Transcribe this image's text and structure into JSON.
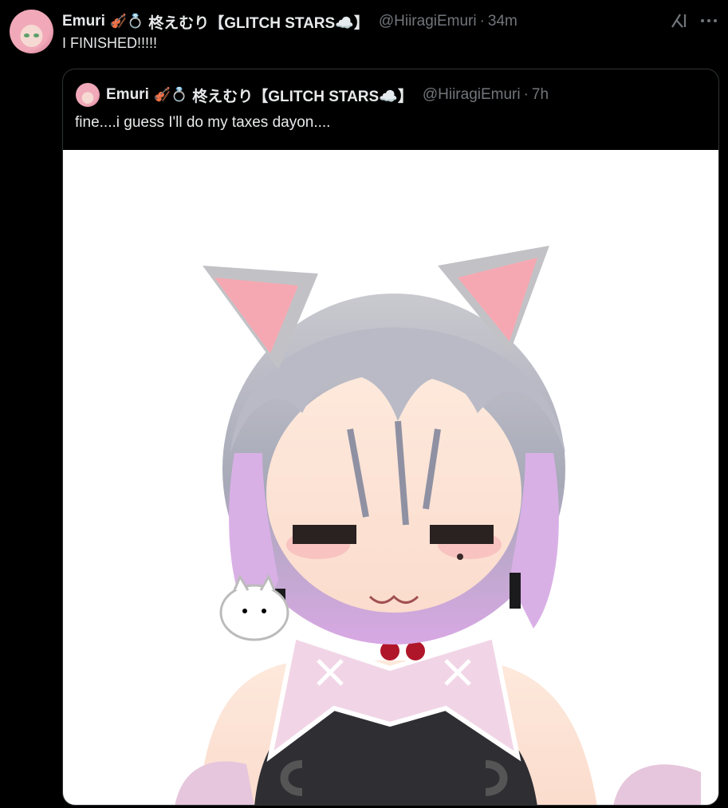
{
  "post": {
    "author_name": "Emuri",
    "author_emoji": "🎻💍",
    "author_suffix": "柊えむり【GLITCH STARS☁️】",
    "handle": "@HiiragiEmuri",
    "separator": "·",
    "time": "34m",
    "text": "I FINISHED!!!!!"
  },
  "quote": {
    "author_name": "Emuri",
    "author_emoji": "🎻💍",
    "author_suffix": "柊えむり【GLITCH STARS☁️】",
    "handle": "@HiiragiEmuri",
    "separator": "·",
    "time": "7h",
    "text": "fine....i guess I'll do my taxes dayon...."
  },
  "icons": {
    "grok": "grok-icon",
    "more": "more-horizontal-icon"
  },
  "colors": {
    "background": "#000000",
    "text_primary": "#e7e9ea",
    "text_secondary": "#71767b",
    "border": "#2f3336"
  }
}
